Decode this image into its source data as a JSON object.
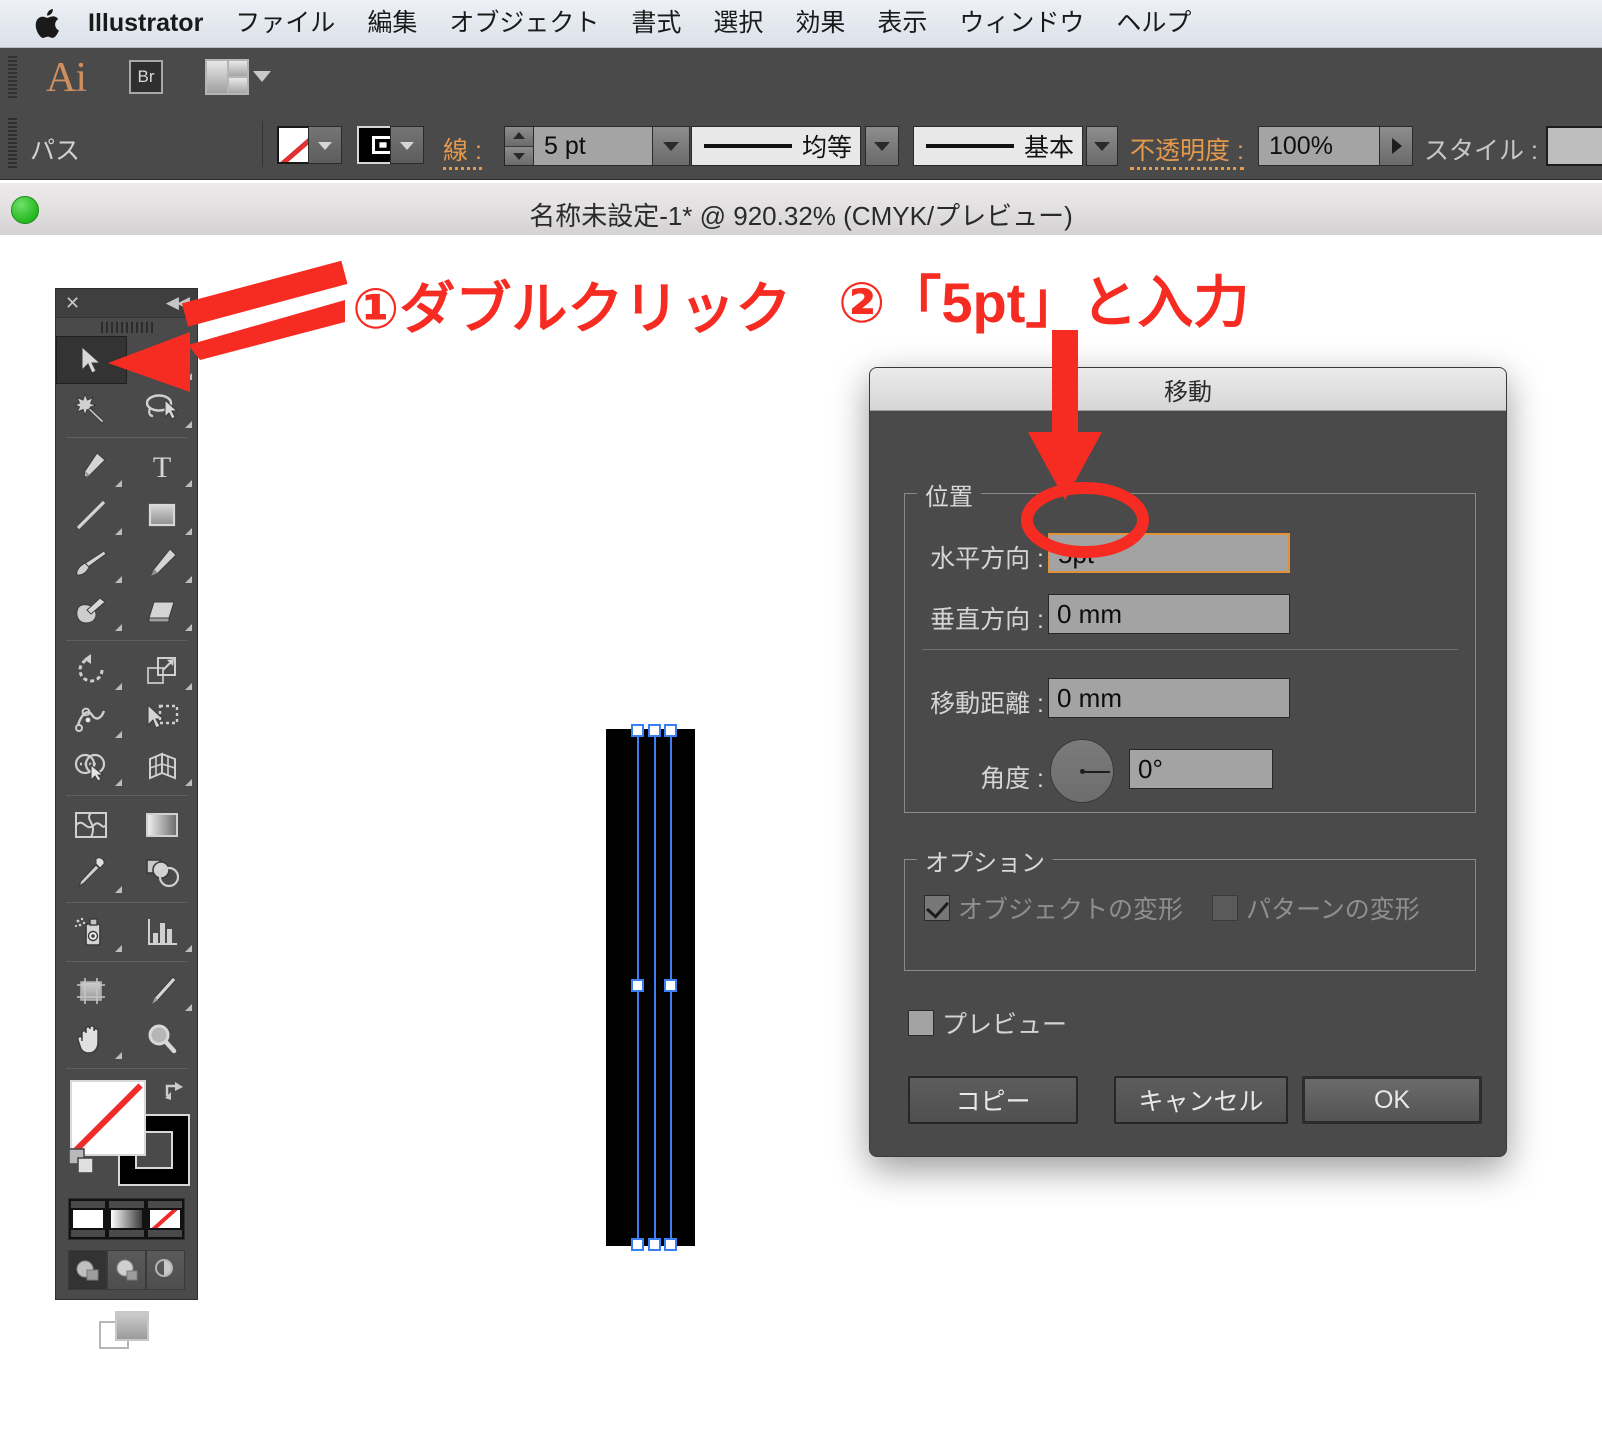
{
  "macmenu": {
    "apple_icon": "apple-logo-icon",
    "items": [
      {
        "label": "Illustrator",
        "bold": true
      },
      {
        "label": "ファイル"
      },
      {
        "label": "編集"
      },
      {
        "label": "オブジェクト"
      },
      {
        "label": "書式"
      },
      {
        "label": "選択"
      },
      {
        "label": "効果"
      },
      {
        "label": "表示"
      },
      {
        "label": "ウィンドウ"
      },
      {
        "label": "ヘルプ"
      }
    ]
  },
  "apptoolbar": {
    "logo": "Ai",
    "bridge_label": "Br",
    "workspace_icon": "workspace-switcher-icon"
  },
  "controlbar": {
    "object_type": "パス",
    "fill_label": "fill-swatch-none",
    "stroke_swatch_label": "stroke-swatch",
    "stroke_label": "線 :",
    "stroke_weight": "5 pt",
    "stroke_profile": "均等",
    "brush_definition": "基本",
    "opacity_label": "不透明度 :",
    "opacity_value": "100%",
    "style_label": "スタイル :"
  },
  "document": {
    "title": "名称未設定-1* @ 920.32% (CMYK/プレビュー)"
  },
  "annotations": {
    "step1": "①ダブルクリック",
    "step2": "②「5pt」と入力"
  },
  "toolpanel": {
    "close_icon": "close-icon",
    "collapse_icon": "collapse-panel-icon",
    "tools": [
      {
        "name": "selection-tool",
        "selected": true
      },
      {
        "name": "direct-selection-tool",
        "selected": false
      },
      {
        "name": "magic-wand-tool",
        "selected": false
      },
      {
        "name": "lasso-tool",
        "selected": false
      },
      {
        "name": "pen-tool",
        "selected": false
      },
      {
        "name": "type-tool",
        "selected": false
      },
      {
        "name": "line-segment-tool",
        "selected": false
      },
      {
        "name": "rectangle-tool",
        "selected": false
      },
      {
        "name": "paintbrush-tool",
        "selected": false
      },
      {
        "name": "pencil-tool",
        "selected": false
      },
      {
        "name": "blob-brush-tool",
        "selected": false
      },
      {
        "name": "eraser-tool",
        "selected": false
      },
      {
        "name": "rotate-tool",
        "selected": false
      },
      {
        "name": "scale-tool",
        "selected": false
      },
      {
        "name": "width-tool",
        "selected": false
      },
      {
        "name": "free-transform-tool",
        "selected": false
      },
      {
        "name": "shape-builder-tool",
        "selected": false
      },
      {
        "name": "perspective-grid-tool",
        "selected": false
      },
      {
        "name": "mesh-tool",
        "selected": false
      },
      {
        "name": "gradient-tool",
        "selected": false
      },
      {
        "name": "eyedropper-tool",
        "selected": false
      },
      {
        "name": "blend-tool",
        "selected": false
      },
      {
        "name": "symbol-sprayer-tool",
        "selected": false
      },
      {
        "name": "column-graph-tool",
        "selected": false
      },
      {
        "name": "artboard-tool",
        "selected": false
      },
      {
        "name": "slice-tool",
        "selected": false
      },
      {
        "name": "hand-tool",
        "selected": false
      },
      {
        "name": "zoom-tool",
        "selected": false
      }
    ],
    "fill_swatch": "none",
    "stroke_swatch": "black",
    "color_modes": [
      "color-swatch",
      "gradient-swatch",
      "none-swatch"
    ],
    "draw_modes": [
      "draw-normal",
      "draw-behind",
      "draw-inside"
    ],
    "screen_mode": "screen-mode-icon"
  },
  "dialog": {
    "title": "移動",
    "position_group": "位置",
    "fields": [
      {
        "label": "水平方向 :",
        "value": "5pt",
        "focused": true
      },
      {
        "label": "垂直方向 :",
        "value": "0 mm",
        "focused": false
      },
      {
        "label": "移動距離 :",
        "value": "0 mm",
        "focused": false
      },
      {
        "label": "角度 :",
        "value": "0°",
        "focused": false
      }
    ],
    "options_group": "オプション",
    "checkboxes": [
      {
        "label": "オブジェクトの変形",
        "checked": true,
        "disabled": true
      },
      {
        "label": "パターンの変形",
        "checked": false,
        "disabled": true
      },
      {
        "label": "プレビュー",
        "checked": false,
        "disabled": false
      }
    ],
    "buttons": [
      {
        "label": "コピー",
        "primary": false
      },
      {
        "label": "キャンセル",
        "primary": false
      },
      {
        "label": "OK",
        "primary": true
      }
    ]
  },
  "colors": {
    "accent_orange": "#e49a4c",
    "annotation_red": "#f62b22",
    "panel_gray": "#4a4a4a",
    "selection_blue": "#3b7ff5",
    "artwork_black": "#000000"
  }
}
